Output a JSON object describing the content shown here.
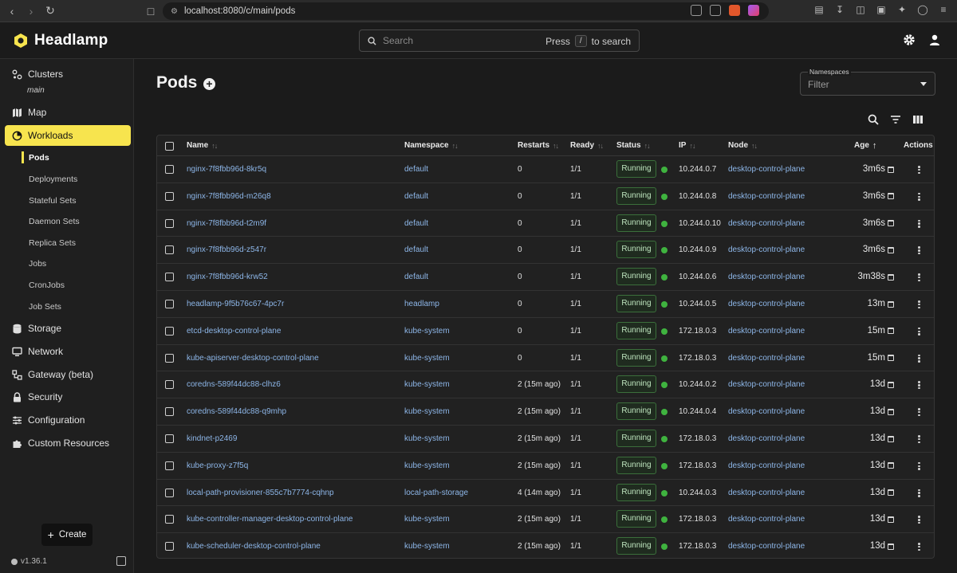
{
  "browser": {
    "url": "localhost:8080/c/main/pods"
  },
  "header": {
    "logo_text": "Headlamp",
    "search_placeholder": "Search",
    "search_hint_prefix": "Press",
    "search_hint_key": "/",
    "search_hint_suffix": "to search"
  },
  "sidebar": {
    "clusters_label": "Clusters",
    "cluster_name": "main",
    "map_label": "Map",
    "workloads_label": "Workloads",
    "sub_items": [
      "Pods",
      "Deployments",
      "Stateful Sets",
      "Daemon Sets",
      "Replica Sets",
      "Jobs",
      "CronJobs",
      "Job Sets"
    ],
    "storage_label": "Storage",
    "network_label": "Network",
    "gateway_label": "Gateway (beta)",
    "security_label": "Security",
    "configuration_label": "Configuration",
    "custom_resources_label": "Custom Resources",
    "create_label": "Create",
    "version": "v1.36.1"
  },
  "main": {
    "title": "Pods",
    "namespaces_label": "Namespaces",
    "namespaces_placeholder": "Filter",
    "columns": {
      "name": "Name",
      "namespace": "Namespace",
      "restarts": "Restarts",
      "ready": "Ready",
      "status": "Status",
      "ip": "IP",
      "node": "Node",
      "age": "Age",
      "actions": "Actions"
    },
    "rows": [
      {
        "name": "nginx-7f8fbb96d-8kr5q",
        "namespace": "default",
        "restarts": "0",
        "ready": "1/1",
        "status": "Running",
        "ip": "10.244.0.7",
        "node": "desktop-control-plane",
        "age": "3m6s"
      },
      {
        "name": "nginx-7f8fbb96d-m26q8",
        "namespace": "default",
        "restarts": "0",
        "ready": "1/1",
        "status": "Running",
        "ip": "10.244.0.8",
        "node": "desktop-control-plane",
        "age": "3m6s"
      },
      {
        "name": "nginx-7f8fbb96d-t2m9f",
        "namespace": "default",
        "restarts": "0",
        "ready": "1/1",
        "status": "Running",
        "ip": "10.244.0.10",
        "node": "desktop-control-plane",
        "age": "3m6s"
      },
      {
        "name": "nginx-7f8fbb96d-z547r",
        "namespace": "default",
        "restarts": "0",
        "ready": "1/1",
        "status": "Running",
        "ip": "10.244.0.9",
        "node": "desktop-control-plane",
        "age": "3m6s"
      },
      {
        "name": "nginx-7f8fbb96d-krw52",
        "namespace": "default",
        "restarts": "0",
        "ready": "1/1",
        "status": "Running",
        "ip": "10.244.0.6",
        "node": "desktop-control-plane",
        "age": "3m38s"
      },
      {
        "name": "headlamp-9f5b76c67-4pc7r",
        "namespace": "headlamp",
        "restarts": "0",
        "ready": "1/1",
        "status": "Running",
        "ip": "10.244.0.5",
        "node": "desktop-control-plane",
        "age": "13m"
      },
      {
        "name": "etcd-desktop-control-plane",
        "namespace": "kube-system",
        "restarts": "0",
        "ready": "1/1",
        "status": "Running",
        "ip": "172.18.0.3",
        "node": "desktop-control-plane",
        "age": "15m"
      },
      {
        "name": "kube-apiserver-desktop-control-plane",
        "namespace": "kube-system",
        "restarts": "0",
        "ready": "1/1",
        "status": "Running",
        "ip": "172.18.0.3",
        "node": "desktop-control-plane",
        "age": "15m"
      },
      {
        "name": "coredns-589f44dc88-clhz6",
        "namespace": "kube-system",
        "restarts": "2 (15m ago)",
        "ready": "1/1",
        "status": "Running",
        "ip": "10.244.0.2",
        "node": "desktop-control-plane",
        "age": "13d"
      },
      {
        "name": "coredns-589f44dc88-q9mhp",
        "namespace": "kube-system",
        "restarts": "2 (15m ago)",
        "ready": "1/1",
        "status": "Running",
        "ip": "10.244.0.4",
        "node": "desktop-control-plane",
        "age": "13d"
      },
      {
        "name": "kindnet-p2469",
        "namespace": "kube-system",
        "restarts": "2 (15m ago)",
        "ready": "1/1",
        "status": "Running",
        "ip": "172.18.0.3",
        "node": "desktop-control-plane",
        "age": "13d"
      },
      {
        "name": "kube-proxy-z7f5q",
        "namespace": "kube-system",
        "restarts": "2 (15m ago)",
        "ready": "1/1",
        "status": "Running",
        "ip": "172.18.0.3",
        "node": "desktop-control-plane",
        "age": "13d"
      },
      {
        "name": "local-path-provisioner-855c7b7774-cqhnp",
        "namespace": "local-path-storage",
        "restarts": "4 (14m ago)",
        "ready": "1/1",
        "status": "Running",
        "ip": "10.244.0.3",
        "node": "desktop-control-plane",
        "age": "13d"
      },
      {
        "name": "kube-controller-manager-desktop-control-plane",
        "namespace": "kube-system",
        "restarts": "2 (15m ago)",
        "ready": "1/1",
        "status": "Running",
        "ip": "172.18.0.3",
        "node": "desktop-control-plane",
        "age": "13d"
      },
      {
        "name": "kube-scheduler-desktop-control-plane",
        "namespace": "kube-system",
        "restarts": "2 (15m ago)",
        "ready": "1/1",
        "status": "Running",
        "ip": "172.18.0.3",
        "node": "desktop-control-plane",
        "age": "13d"
      }
    ]
  },
  "colors": {
    "accent": "#f7e44e",
    "link": "#8db6e8",
    "running": "#3fb33f"
  }
}
